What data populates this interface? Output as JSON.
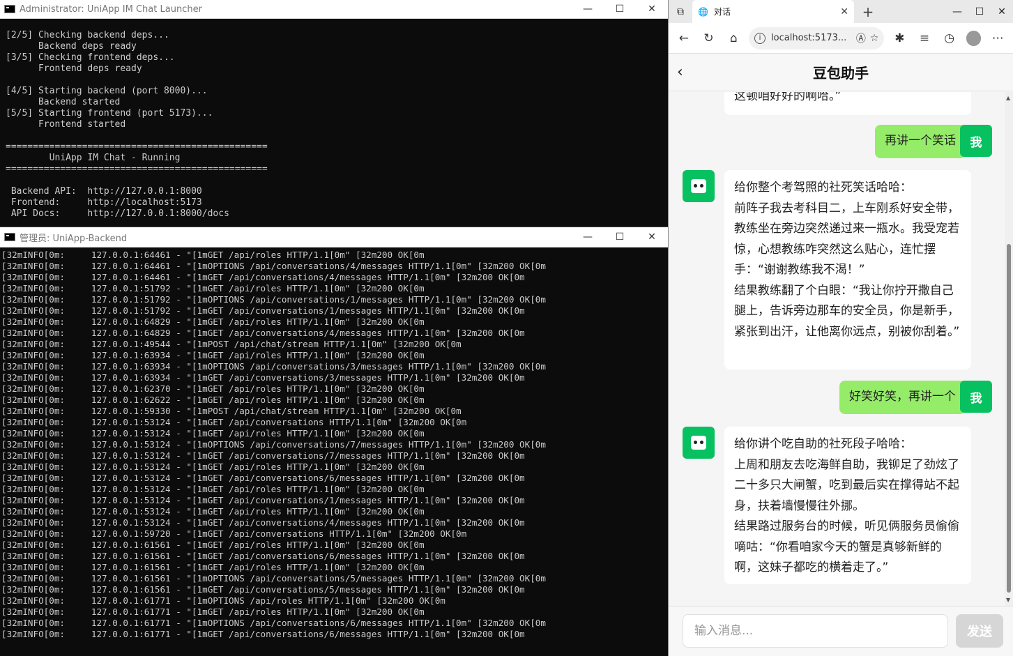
{
  "launcher": {
    "title": "Administrator:  UniApp IM Chat Launcher",
    "lines": [
      "[2/5] Checking backend deps...",
      "      Backend deps ready",
      "[3/5] Checking frontend deps...",
      "      Frontend deps ready",
      "",
      "[4/5] Starting backend (port 8000)...",
      "      Backend started",
      "[5/5] Starting frontend (port 5173)...",
      "      Frontend started",
      "",
      "================================================",
      "        UniApp IM Chat - Running",
      "================================================",
      "",
      " Backend API:  http://127.0.0.1:8000",
      " Frontend:     http://localhost:5173",
      " API Docs:     http://127.0.0.1:8000/docs"
    ]
  },
  "backend": {
    "title": "管理员:  UniApp-Backend",
    "lines": [
      "[32mINFO[0m:     127.0.0.1:64461 - \"[1mGET /api/roles HTTP/1.1[0m\" [32m200 OK[0m",
      "[32mINFO[0m:     127.0.0.1:64461 - \"[1mOPTIONS /api/conversations/4/messages HTTP/1.1[0m\" [32m200 OK[0m",
      "[32mINFO[0m:     127.0.0.1:64461 - \"[1mGET /api/conversations/4/messages HTTP/1.1[0m\" [32m200 OK[0m",
      "[32mINFO[0m:     127.0.0.1:51792 - \"[1mGET /api/roles HTTP/1.1[0m\" [32m200 OK[0m",
      "[32mINFO[0m:     127.0.0.1:51792 - \"[1mOPTIONS /api/conversations/1/messages HTTP/1.1[0m\" [32m200 OK[0m",
      "[32mINFO[0m:     127.0.0.1:51792 - \"[1mGET /api/conversations/1/messages HTTP/1.1[0m\" [32m200 OK[0m",
      "[32mINFO[0m:     127.0.0.1:64829 - \"[1mGET /api/roles HTTP/1.1[0m\" [32m200 OK[0m",
      "[32mINFO[0m:     127.0.0.1:64829 - \"[1mGET /api/conversations/4/messages HTTP/1.1[0m\" [32m200 OK[0m",
      "[32mINFO[0m:     127.0.0.1:49544 - \"[1mPOST /api/chat/stream HTTP/1.1[0m\" [32m200 OK[0m",
      "[32mINFO[0m:     127.0.0.1:63934 - \"[1mGET /api/roles HTTP/1.1[0m\" [32m200 OK[0m",
      "[32mINFO[0m:     127.0.0.1:63934 - \"[1mOPTIONS /api/conversations/3/messages HTTP/1.1[0m\" [32m200 OK[0m",
      "[32mINFO[0m:     127.0.0.1:63934 - \"[1mGET /api/conversations/3/messages HTTP/1.1[0m\" [32m200 OK[0m",
      "[32mINFO[0m:     127.0.0.1:62370 - \"[1mGET /api/roles HTTP/1.1[0m\" [32m200 OK[0m",
      "[32mINFO[0m:     127.0.0.1:62622 - \"[1mGET /api/roles HTTP/1.1[0m\" [32m200 OK[0m",
      "[32mINFO[0m:     127.0.0.1:59330 - \"[1mPOST /api/chat/stream HTTP/1.1[0m\" [32m200 OK[0m",
      "[32mINFO[0m:     127.0.0.1:53124 - \"[1mGET /api/conversations HTTP/1.1[0m\" [32m200 OK[0m",
      "[32mINFO[0m:     127.0.0.1:53124 - \"[1mGET /api/roles HTTP/1.1[0m\" [32m200 OK[0m",
      "[32mINFO[0m:     127.0.0.1:53124 - \"[1mOPTIONS /api/conversations/7/messages HTTP/1.1[0m\" [32m200 OK[0m",
      "[32mINFO[0m:     127.0.0.1:53124 - \"[1mGET /api/conversations/7/messages HTTP/1.1[0m\" [32m200 OK[0m",
      "[32mINFO[0m:     127.0.0.1:53124 - \"[1mGET /api/roles HTTP/1.1[0m\" [32m200 OK[0m",
      "[32mINFO[0m:     127.0.0.1:53124 - \"[1mGET /api/conversations/6/messages HTTP/1.1[0m\" [32m200 OK[0m",
      "[32mINFO[0m:     127.0.0.1:53124 - \"[1mGET /api/roles HTTP/1.1[0m\" [32m200 OK[0m",
      "[32mINFO[0m:     127.0.0.1:53124 - \"[1mGET /api/conversations/1/messages HTTP/1.1[0m\" [32m200 OK[0m",
      "[32mINFO[0m:     127.0.0.1:53124 - \"[1mGET /api/roles HTTP/1.1[0m\" [32m200 OK[0m",
      "[32mINFO[0m:     127.0.0.1:53124 - \"[1mGET /api/conversations/4/messages HTTP/1.1[0m\" [32m200 OK[0m",
      "[32mINFO[0m:     127.0.0.1:59720 - \"[1mGET /api/conversations HTTP/1.1[0m\" [32m200 OK[0m",
      "[32mINFO[0m:     127.0.0.1:61561 - \"[1mGET /api/roles HTTP/1.1[0m\" [32m200 OK[0m",
      "[32mINFO[0m:     127.0.0.1:61561 - \"[1mGET /api/conversations/6/messages HTTP/1.1[0m\" [32m200 OK[0m",
      "[32mINFO[0m:     127.0.0.1:61561 - \"[1mGET /api/roles HTTP/1.1[0m\" [32m200 OK[0m",
      "[32mINFO[0m:     127.0.0.1:61561 - \"[1mOPTIONS /api/conversations/5/messages HTTP/1.1[0m\" [32m200 OK[0m",
      "[32mINFO[0m:     127.0.0.1:61561 - \"[1mGET /api/conversations/5/messages HTTP/1.1[0m\" [32m200 OK[0m",
      "[32mINFO[0m:     127.0.0.1:61771 - \"[1mOPTIONS /api/roles HTTP/1.1[0m\" [32m200 OK[0m",
      "[32mINFO[0m:     127.0.0.1:61771 - \"[1mGET /api/roles HTTP/1.1[0m\" [32m200 OK[0m",
      "[32mINFO[0m:     127.0.0.1:61771 - \"[1mOPTIONS /api/conversations/6/messages HTTP/1.1[0m\" [32m200 OK[0m",
      "[32mINFO[0m:     127.0.0.1:61771 - \"[1mGET /api/conversations/6/messages HTTP/1.1[0m\" [32m200 OK[0m"
    ]
  },
  "browser": {
    "tab_title": "对话",
    "url": "localhost:5173...",
    "header_title": "豆包助手",
    "back_glyph": "‹",
    "messages": [
      {
        "role": "bot",
        "text": "这顿咱好好的啊哈。”"
      },
      {
        "role": "user",
        "text": "再讲一个笑话",
        "avatar": "我"
      },
      {
        "role": "bot",
        "text": "给你整个考驾照的社死笑话哈哈：\n前阵子我去考科目二，上车刚系好安全带，教练坐在旁边突然递过来一瓶水。我受宠若惊，心想教练咋突然这么贴心，连忙摆手：“谢谢教练我不渴！”\n结果教练翻了个白眼：“我让你拧开撒自己腿上，告诉旁边那车的安全员，你是新手，紧张到出汗，让他离你远点，别被你刮着。”"
      },
      {
        "role": "user",
        "text": "好笑好笑，再讲一个",
        "avatar": "我"
      },
      {
        "role": "bot",
        "text": "给你讲个吃自助的社死段子哈哈：\n上周和朋友去吃海鲜自助，我铆足了劲炫了二十多只大闸蟹，吃到最后实在撑得站不起身，扶着墙慢慢往外挪。\n结果路过服务台的时候，听见俩服务员偷偷嘀咕：“你看咱家今天的蟹是真够新鲜的啊，这妹子都吃的横着走了。”"
      }
    ],
    "input_placeholder": "输入消息...",
    "send_label": "发送",
    "colors": {
      "accent": "#07c160",
      "user_bubble": "#95ec69",
      "send_disabled": "#d6d6d6"
    }
  }
}
